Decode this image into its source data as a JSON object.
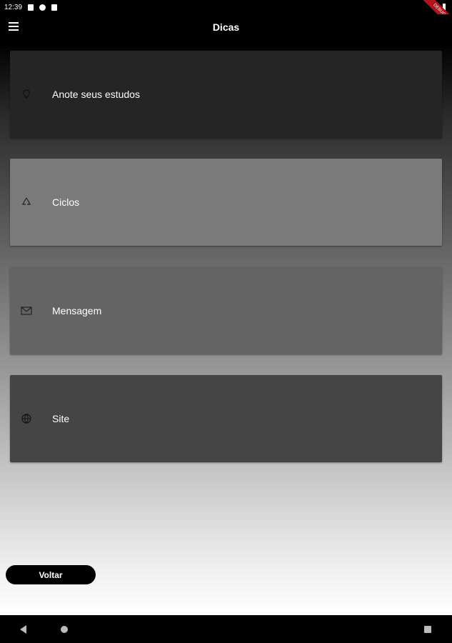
{
  "status_bar": {
    "time": "12:39"
  },
  "debug_banner": "DEBUG",
  "app_bar": {
    "title": "Dicas"
  },
  "cards": [
    {
      "label": "Anote seus estudos",
      "icon": "pin-icon",
      "color": "#252525"
    },
    {
      "label": "Ciclos",
      "icon": "recycle-icon",
      "color": "#7a7a7a"
    },
    {
      "label": "Mensagem",
      "icon": "mail-icon",
      "color": "#646464"
    },
    {
      "label": "Site",
      "icon": "globe-icon",
      "color": "#454545"
    }
  ],
  "voltar_label": "Voltar"
}
